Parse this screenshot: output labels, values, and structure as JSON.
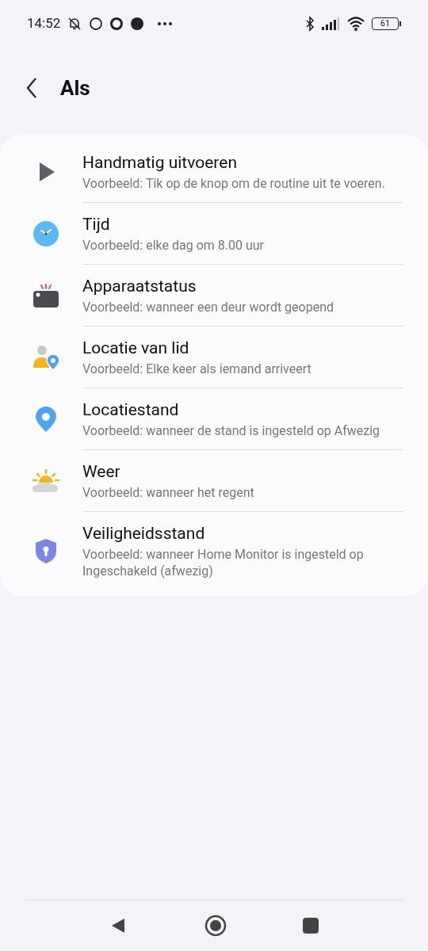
{
  "status_bar": {
    "time": "14:52",
    "battery": "61"
  },
  "header": {
    "title": "Als"
  },
  "items": [
    {
      "kind": "play",
      "title": "Handmatig uitvoeren",
      "subtitle": "Voorbeeld: Tik op de knop om de routine uit te voeren."
    },
    {
      "kind": "clock",
      "title": "Tijd",
      "subtitle": "Voorbeeld: elke dag om 8.00 uur"
    },
    {
      "kind": "device",
      "title": "Apparaatstatus",
      "subtitle": "Voorbeeld: wanneer een deur wordt geopend"
    },
    {
      "kind": "member",
      "title": "Locatie van lid",
      "subtitle": "Voorbeeld: Elke keer als iemand arriveert"
    },
    {
      "kind": "pin",
      "title": "Locatiestand",
      "subtitle": "Voorbeeld: wanneer de stand is ingesteld op Afwezig"
    },
    {
      "kind": "weather",
      "title": "Weer",
      "subtitle": "Voorbeeld: wanneer het regent"
    },
    {
      "kind": "shield",
      "title": "Veiligheidsstand",
      "subtitle": "Voorbeeld: wanneer Home Monitor is ingesteld op Ingeschakeld (afwezig)"
    }
  ]
}
